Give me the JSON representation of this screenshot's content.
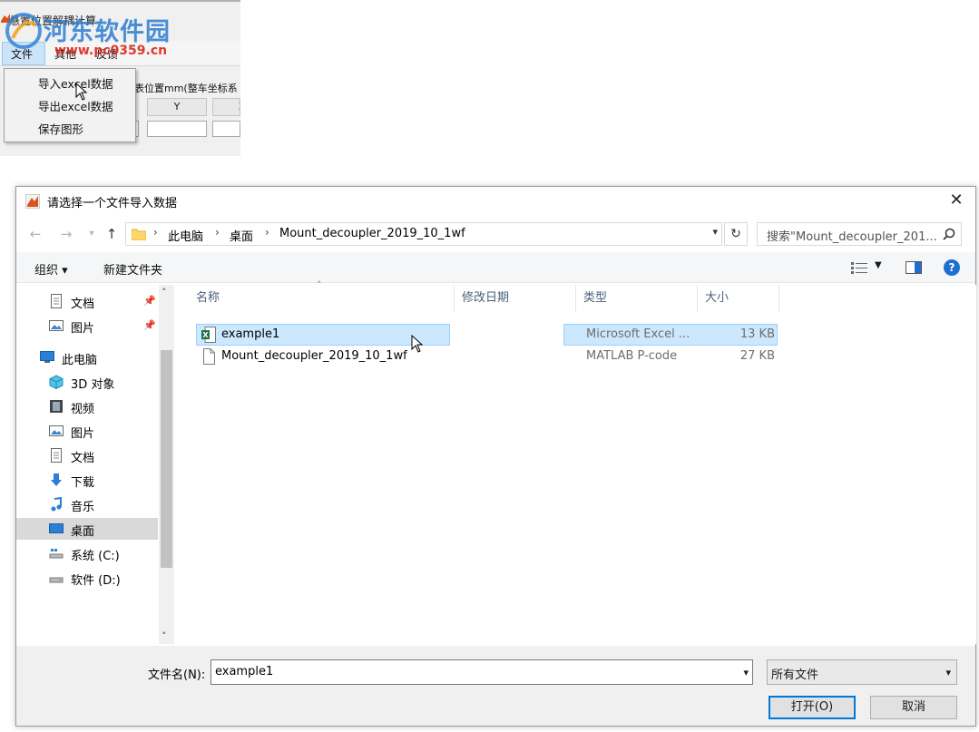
{
  "app": {
    "title": "悬置位置解耦计算",
    "menu": [
      "文件",
      "其他",
      "反馈"
    ],
    "panel_label": "表位置mm(整车坐标系",
    "col_y": "Y",
    "col_z": "Z",
    "file_menu": [
      "导入excel数据",
      "导出excel数据",
      "保存图形"
    ]
  },
  "watermark": {
    "text": "河东软件园",
    "url": "www.pc0359.cn"
  },
  "dialog": {
    "title": "请选择一个文件导入数据",
    "close": "✕",
    "breadcrumb": [
      "此电脑",
      "桌面",
      "Mount_decoupler_2019_10_1wf"
    ],
    "search_placeholder": "搜索\"Mount_decoupler_201...",
    "toolbar": {
      "organize": "组织 ▾",
      "new_folder": "新建文件夹"
    },
    "nav_items": [
      {
        "label": "文档",
        "icon": "document-icon",
        "pinned": true
      },
      {
        "label": "图片",
        "icon": "pictures-icon",
        "pinned": true
      },
      {
        "label": "此电脑",
        "icon": "computer-icon",
        "pinned": false
      },
      {
        "label": "3D 对象",
        "icon": "3d-objects-icon",
        "pinned": false
      },
      {
        "label": "视频",
        "icon": "video-icon",
        "pinned": false
      },
      {
        "label": "图片",
        "icon": "pictures-icon",
        "pinned": false
      },
      {
        "label": "文档",
        "icon": "document-icon",
        "pinned": false
      },
      {
        "label": "下载",
        "icon": "download-icon",
        "pinned": false
      },
      {
        "label": "音乐",
        "icon": "music-icon",
        "pinned": false
      },
      {
        "label": "桌面",
        "icon": "desktop-icon",
        "pinned": false,
        "selected": true
      },
      {
        "label": "系统 (C:)",
        "icon": "system-drive-icon",
        "pinned": false
      },
      {
        "label": "软件 (D:)",
        "icon": "drive-icon",
        "pinned": false
      }
    ],
    "columns": {
      "name": "名称",
      "modified": "修改日期",
      "type": "类型",
      "size": "大小"
    },
    "files": [
      {
        "name": "example1",
        "modified": "",
        "type": "Microsoft Excel ...",
        "size": "13 KB",
        "icon": "excel-file-icon",
        "selected": true
      },
      {
        "name": "Mount_decoupler_2019_10_1wf",
        "modified": "",
        "type": "MATLAB P-code",
        "size": "27 KB",
        "icon": "file-icon",
        "selected": false
      }
    ],
    "filename_label": "文件名(N):",
    "filename_value": "example1",
    "filter_value": "所有文件",
    "open_button": "打开(O)",
    "cancel_button": "取消"
  },
  "colors": {
    "accent": "#0078d7",
    "selection": "#cce8ff",
    "header_text": "#4c607a",
    "help": "#1f6fd1"
  }
}
